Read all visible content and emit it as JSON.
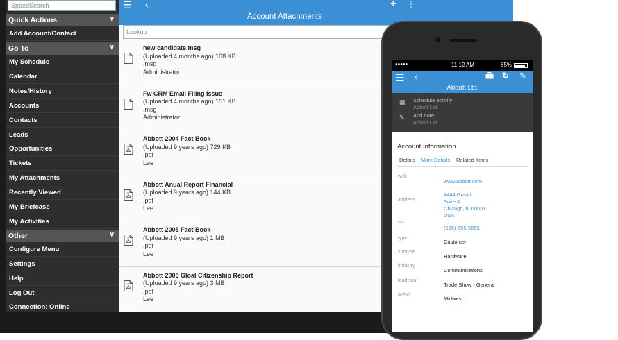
{
  "tablet": {
    "sidebar": {
      "search_placeholder": "SpeedSearch",
      "quick_actions_header": "Quick Actions",
      "quick_actions": [
        {
          "label": "Add Account/Contact"
        }
      ],
      "goto_header": "Go To",
      "goto_items": [
        {
          "label": "My Schedule"
        },
        {
          "label": "Calendar"
        },
        {
          "label": "Notes/History"
        },
        {
          "label": "Accounts"
        },
        {
          "label": "Contacts"
        },
        {
          "label": "Leads"
        },
        {
          "label": "Opportunities"
        },
        {
          "label": "Tickets"
        },
        {
          "label": "My Attachments"
        },
        {
          "label": "Recently Viewed"
        },
        {
          "label": "My Briefcase"
        },
        {
          "label": "My Activities"
        }
      ],
      "other_header": "Other",
      "other_items": [
        {
          "label": "Configure Menu"
        },
        {
          "label": "Settings"
        },
        {
          "label": "Help"
        },
        {
          "label": "Log Out"
        },
        {
          "label": "Connection: Online"
        }
      ],
      "chevron_icon": "chevron-down-icon"
    },
    "header": {
      "title": "Account Attachments",
      "menu_icon": "☰",
      "back_icon": "‹",
      "add_icon": "+",
      "more_icon": "⋮"
    },
    "lookup_placeholder": "Lookup",
    "attachments": [
      {
        "name": "new candidate.msg",
        "uploaded": "(Uploaded 4 months ago) 108 KB",
        "ext": ".msg",
        "user": "Administrator",
        "icon": "document-icon"
      },
      {
        "name": "Fw CRM Email Filing Issue",
        "uploaded": "(Uploaded 4 months ago) 151 KB",
        "ext": ".msg",
        "user": "Administrator",
        "icon": "document-icon"
      },
      {
        "name": "Abbott 2004 Fact Book",
        "uploaded": "(Uploaded 9 years ago) 729 KB",
        "ext": ".pdf",
        "user": "Lee",
        "icon": "pdf-document-icon"
      },
      {
        "name": "Abbott Anual Report Financial",
        "uploaded": "(Uploaded 9 years ago) 144 KB",
        "ext": ".pdf",
        "user": "Lee",
        "icon": "pdf-document-icon"
      },
      {
        "name": "Abbott 2005 Fact Book",
        "uploaded": "(Uploaded 9 years ago) 1 MB",
        "ext": ".pdf",
        "user": "Lee",
        "icon": "pdf-document-icon"
      },
      {
        "name": "Abbott 2005 Gloal Citizenship Report",
        "uploaded": "(Uploaded 9 years ago) 3 MB",
        "ext": ".pdf",
        "user": "Lee",
        "icon": "pdf-document-icon"
      }
    ]
  },
  "phone": {
    "status": {
      "time": "11:12 AM",
      "battery_pct": "85%",
      "battery_level": 0.85
    },
    "header": {
      "title": "Abbott Ltd.",
      "menu_icon": "☰",
      "back_icon": "‹",
      "briefcase_icon": "briefcase-icon",
      "refresh_icon": "↻",
      "edit_icon": "✎"
    },
    "actions": [
      {
        "label": "Schedule activity",
        "sub": "Abbott Ltd.",
        "icon": "calendar-icon"
      },
      {
        "label": "Add note",
        "sub": "Abbott Ltd.",
        "icon": "edit-note-icon"
      }
    ],
    "section_title": "Account Information",
    "tabs": [
      "Details",
      "More Details",
      "Related Items"
    ],
    "active_tab": "More Details",
    "fields": [
      {
        "label": "web",
        "value": "www.abbott.com",
        "link": true
      },
      {
        "label": "address",
        "value": "4444 Grand",
        "link": true
      },
      {
        "label": "",
        "value": "Suite 4",
        "link": true
      },
      {
        "label": "",
        "value": "Chicago, IL 60651",
        "link": true
      },
      {
        "label": "",
        "value": "USA",
        "link": true
      },
      {
        "label": "fax",
        "value": "(555)-555-5555",
        "link": true
      },
      {
        "label": "type",
        "value": "Customer",
        "link": false
      },
      {
        "label": "subtype",
        "value": "Hardware",
        "link": false
      },
      {
        "label": "industry",
        "value": "Communications",
        "link": false
      },
      {
        "label": "lead sour",
        "value": "Trade Show - General",
        "link": false
      },
      {
        "label": "owner",
        "value": "Midwest",
        "link": false
      }
    ]
  },
  "colors": {
    "accent": "#3b8fd4",
    "sidebar_bg": "#2e2e2e",
    "section_header_bg": "#555555",
    "device_body": "#1b1b1d"
  }
}
